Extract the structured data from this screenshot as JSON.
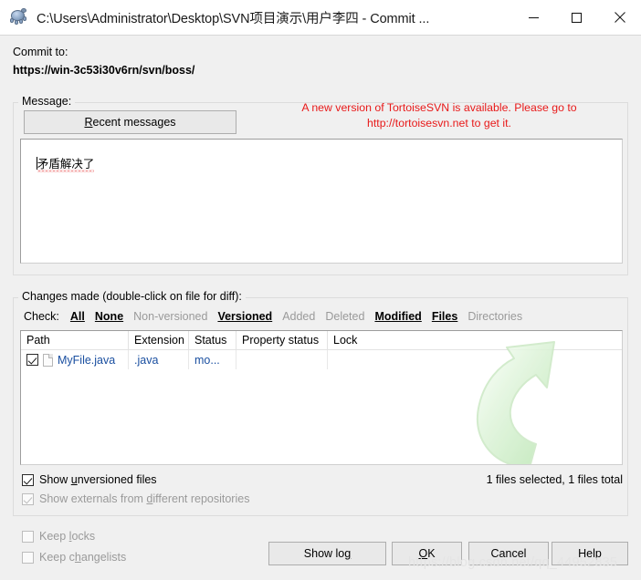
{
  "window": {
    "title": "C:\\Users\\Administrator\\Desktop\\SVN项目演示\\用户李四 - Commit ...",
    "icon": "tortoise-icon",
    "minimize_label": "Minimize",
    "maximize_label": "Maximize",
    "close_label": "Close"
  },
  "commit_to": {
    "label": "Commit to:",
    "url": "https://win-3c53i30v6rn/svn/boss/"
  },
  "message_group": {
    "title": "Message:",
    "recent_messages_label": "Recent messages",
    "recent_messages_accel": "R",
    "update_notice_line1": "A new version of TortoiseSVN is available. Please go to",
    "update_notice_line2": "http://tortoisesvn.net to get it.",
    "update_notice_color": "#e81919",
    "message_value": "矛盾解决了",
    "message_placeholder": ""
  },
  "changes_group": {
    "title": "Changes made (double-click on file for diff):",
    "check_label": "Check:",
    "check_links": [
      {
        "label": "All",
        "enabled": true
      },
      {
        "label": "None",
        "enabled": true
      },
      {
        "label": "Non-versioned",
        "enabled": false
      },
      {
        "label": "Versioned",
        "enabled": true
      },
      {
        "label": "Added",
        "enabled": false
      },
      {
        "label": "Deleted",
        "enabled": false
      },
      {
        "label": "Modified",
        "enabled": true
      },
      {
        "label": "Files",
        "enabled": true
      },
      {
        "label": "Directories",
        "enabled": false
      }
    ],
    "columns": [
      "Path",
      "Extension",
      "Status",
      "Property status",
      "Lock"
    ],
    "rows": [
      {
        "checked": true,
        "icon": "file-icon",
        "path": "MyFile.java",
        "extension": ".java",
        "status": "mo...",
        "property_status": "",
        "lock": ""
      }
    ],
    "watermark_icon": "commit-arrow-icon",
    "files_status": "1 files selected, 1 files total"
  },
  "options": {
    "show_unversioned": {
      "label": "Show unversioned files",
      "checked": true,
      "enabled": true,
      "accel": "u"
    },
    "show_externals": {
      "label": "Show externals from different repositories",
      "checked": true,
      "enabled": false,
      "accel": "d"
    },
    "keep_locks": {
      "label": "Keep locks",
      "checked": false,
      "enabled": false,
      "accel": "l"
    },
    "keep_changelists": {
      "label": "Keep changelists",
      "checked": false,
      "enabled": false,
      "accel": "h"
    }
  },
  "footer": {
    "show_log_label": "Show log",
    "show_log_accel": "g",
    "ok_label": "OK",
    "ok_accel": "O",
    "cancel_label": "Cancel",
    "help_label": "Help"
  },
  "watermark": {
    "text": "https://blog.csdn.net/qq_44952835"
  },
  "colors": {
    "dialog_bg": "#f0f0f0",
    "titlebar_bg": "#ffffff",
    "field_bg": "#ffffff",
    "link_blue": "#1a4fa0",
    "notice_red": "#e81919",
    "disabled_gray": "#9a9a9a",
    "arrow_green": "#c9ecc4"
  }
}
